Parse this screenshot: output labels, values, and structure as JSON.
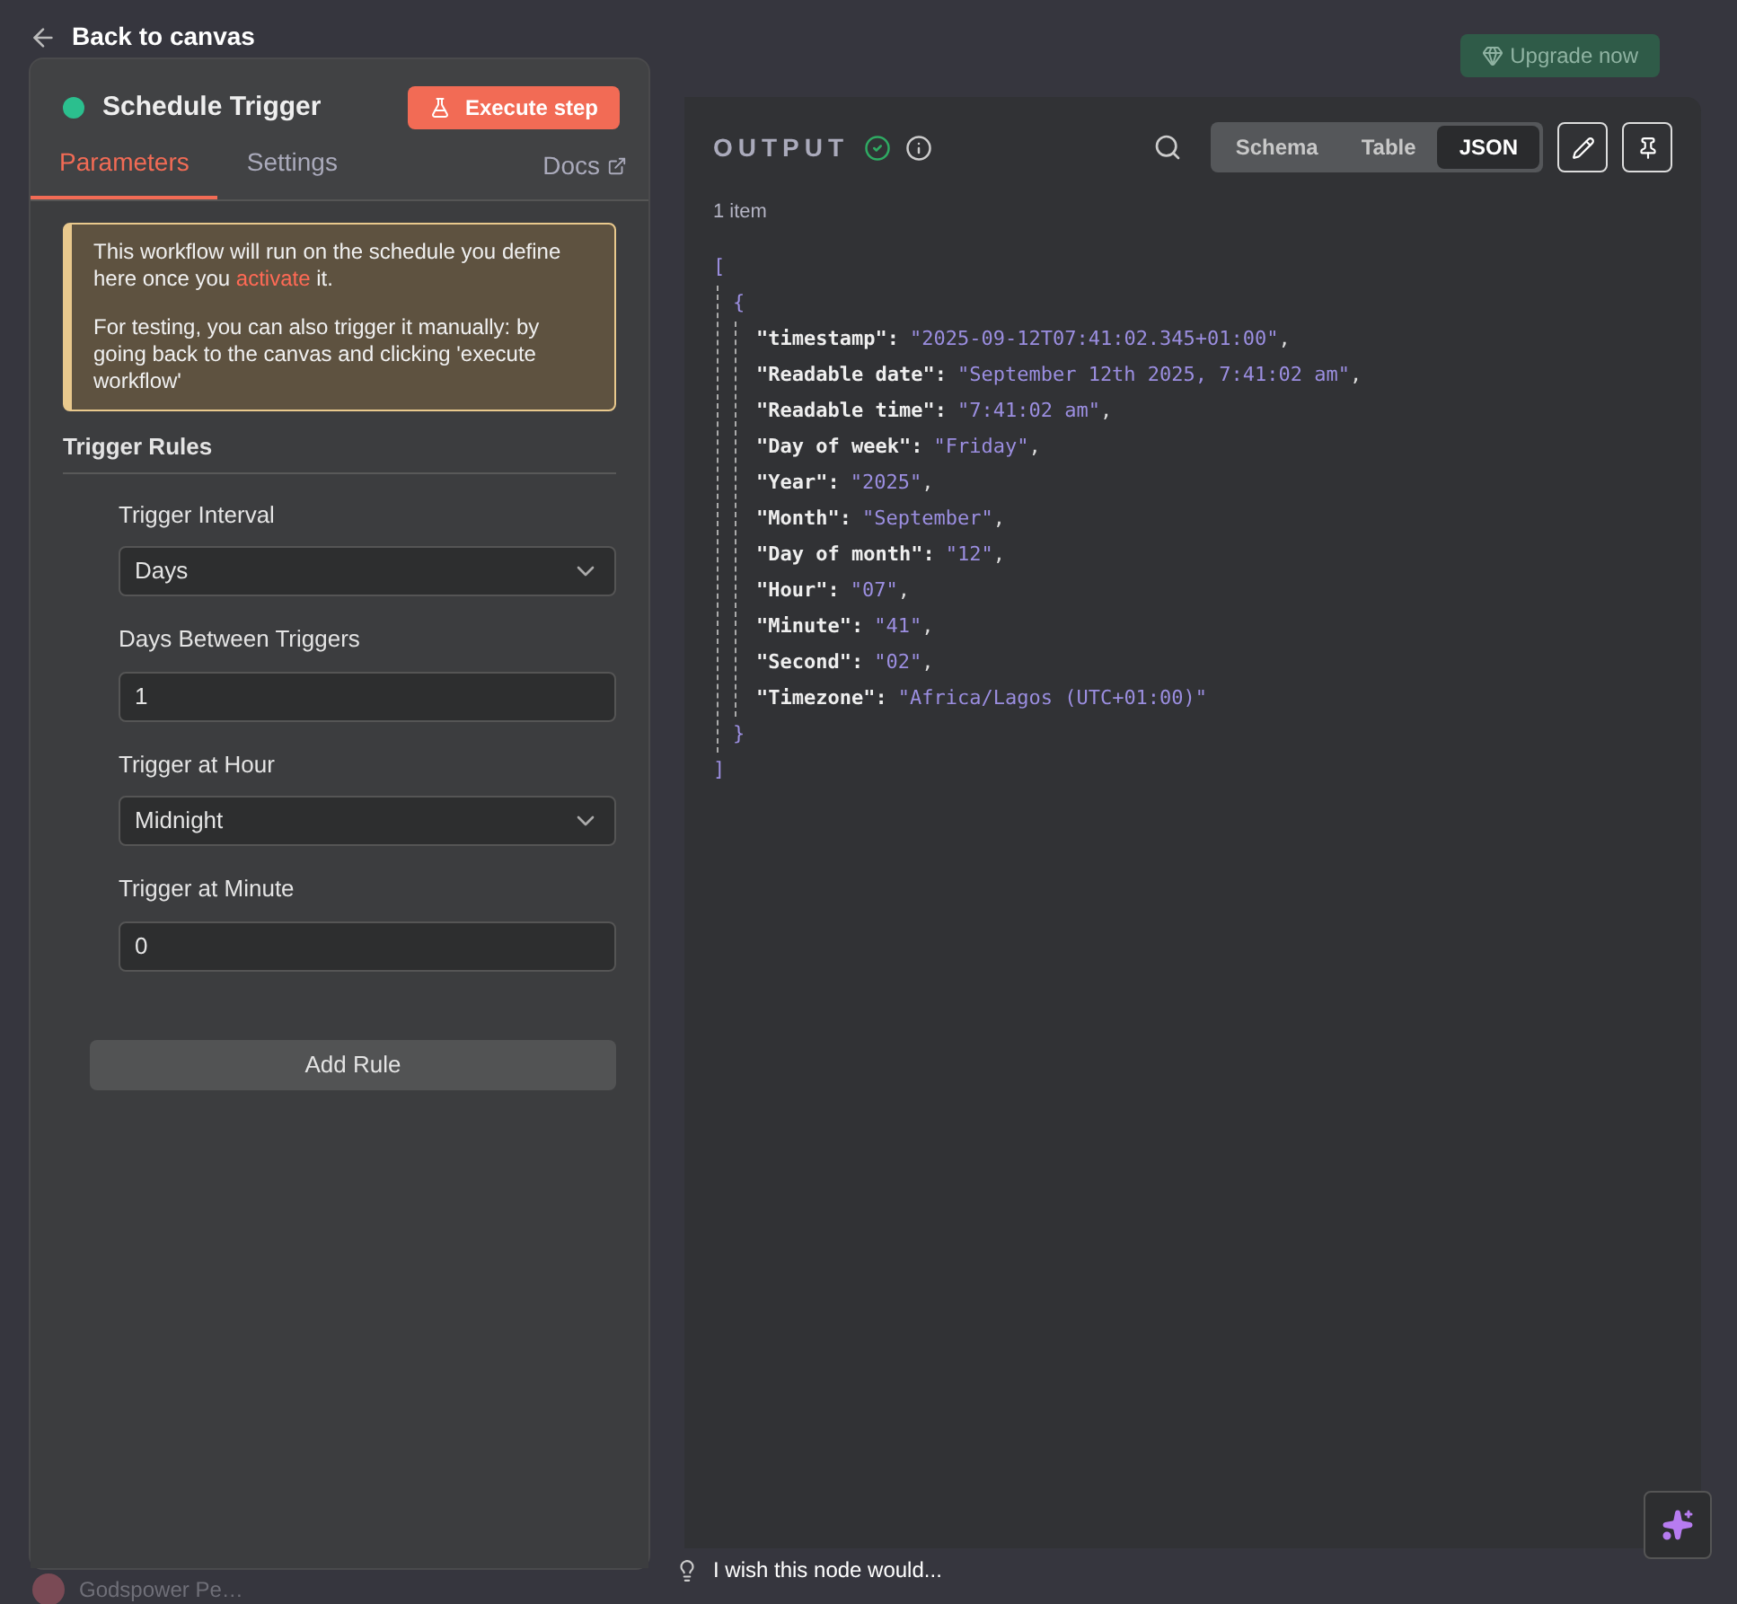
{
  "back_link": "Back to canvas",
  "background": {
    "upgrade_button": "Upgrade now",
    "user_name": "Godspower Pe…"
  },
  "node_panel": {
    "title": "Schedule Trigger",
    "execute_button": "Execute step",
    "tabs": [
      {
        "label": "Parameters",
        "selected": true
      },
      {
        "label": "Settings",
        "selected": false
      }
    ],
    "docs_link": "Docs",
    "notice": {
      "line_1": "This workflow will run on the schedule you define here once you ",
      "link": "activate",
      "line_1_end": " it.",
      "line_2": "For testing, you can also trigger it manually: by going back to the canvas and clicking 'execute workflow'"
    },
    "section_title": "Trigger Rules",
    "fields": [
      {
        "kind": "select",
        "label": "Trigger Interval",
        "value": "Days"
      },
      {
        "kind": "number",
        "label": "Days Between Triggers",
        "value": "1"
      },
      {
        "kind": "select",
        "label": "Trigger at Hour",
        "value": "Midnight"
      },
      {
        "kind": "number",
        "label": "Trigger at Minute",
        "value": "0"
      }
    ],
    "add_button": "Add Rule"
  },
  "output_panel": {
    "title": "OUTPUT",
    "view_tabs": [
      {
        "label": "Schema",
        "selected": false
      },
      {
        "label": "Table",
        "selected": false
      },
      {
        "label": "JSON",
        "selected": true
      }
    ],
    "item_count": "1 item",
    "open_bracket": "[",
    "open_brace": "{",
    "close_brace": "}",
    "close_bracket": "]",
    "lines": [
      {
        "key": "\"timestamp\":",
        "value": "\"2025-09-12T07:41:02.345+01:00\"",
        "trailing": ","
      },
      {
        "key": "\"Readable date\":",
        "value": "\"September 12th 2025, 7:41:02 am\"",
        "trailing": ","
      },
      {
        "key": "\"Readable time\":",
        "value": "\"7:41:02 am\"",
        "trailing": ","
      },
      {
        "key": "\"Day of week\":",
        "value": "\"Friday\"",
        "trailing": ","
      },
      {
        "key": "\"Year\":",
        "value": "\"2025\"",
        "trailing": ","
      },
      {
        "key": "\"Month\":",
        "value": "\"September\"",
        "trailing": ","
      },
      {
        "key": "\"Day of month\":",
        "value": "\"12\"",
        "trailing": ","
      },
      {
        "key": "\"Hour\":",
        "value": "\"07\"",
        "trailing": ","
      },
      {
        "key": "\"Minute\":",
        "value": "\"41\"",
        "trailing": ","
      },
      {
        "key": "\"Second\":",
        "value": "\"02\"",
        "trailing": ","
      },
      {
        "key": "\"Timezone\":",
        "value": "\"Africa/Lagos (UTC+01:00)\""
      }
    ]
  },
  "feedback_prompt": "I wish this node would..."
}
